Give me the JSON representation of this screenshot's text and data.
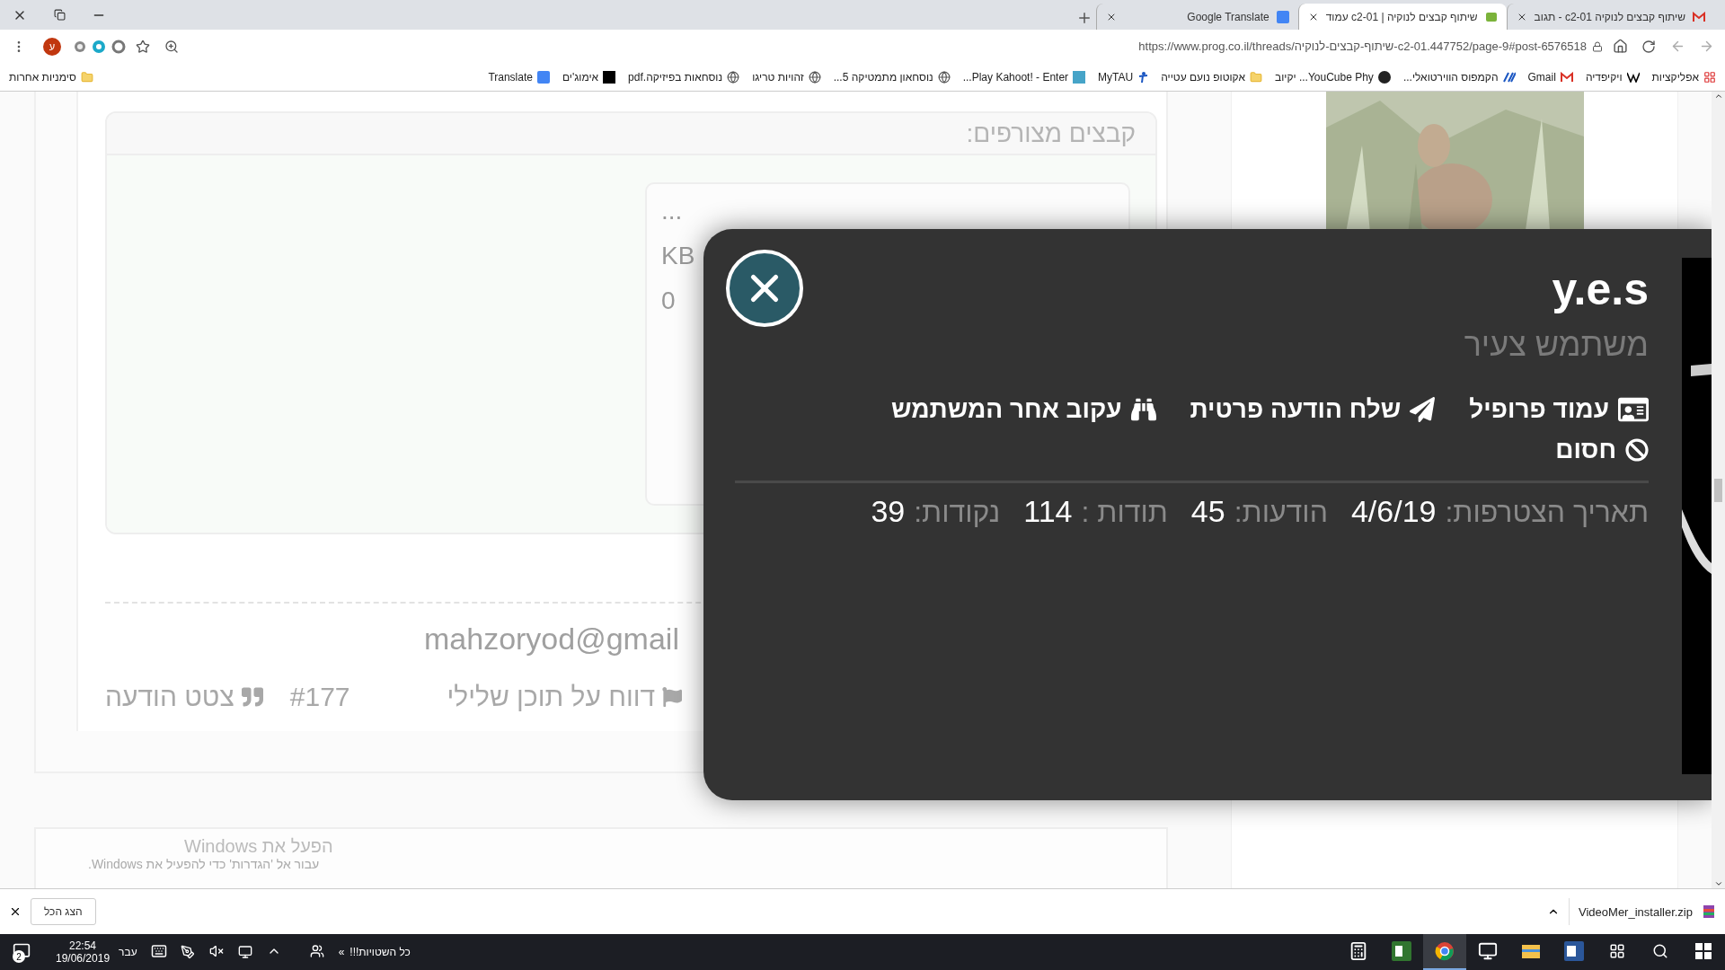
{
  "browser": {
    "tabs": [
      {
        "title": "שיתוף קבצים לנוקיה c2-01 - תגוב",
        "kind": "mail",
        "selected": false
      },
      {
        "title": "שיתוף קבצים לנוקיה | c2-01 עמוד",
        "kind": "forum",
        "selected": true
      },
      {
        "title": "Google Translate",
        "kind": "translate",
        "selected": false
      }
    ],
    "profile_initial": "ע",
    "url": "https://www.prog.co.il/threads/שיתוף-קבצים-לנוקיה-c2-01.447752/page-9#post-6576518",
    "bookmarks": [
      {
        "label": "אפליקציות",
        "kind": "apps"
      },
      {
        "label": "ויקיפדיה",
        "kind": "wiki"
      },
      {
        "label": "Gmail",
        "kind": "mail"
      },
      {
        "label": "הקמפוס הווירטואלי...",
        "kind": "campus"
      },
      {
        "label": "YouCube Phy... יקיוב",
        "kind": "m"
      },
      {
        "label": "אקוטופ נועם עטייה",
        "kind": "folder"
      },
      {
        "label": "MyTAU",
        "kind": "tau"
      },
      {
        "label": "Play Kahoot! - Enter...",
        "kind": "kahoot"
      },
      {
        "label": "נוסחאון מתמטיקה 5...",
        "kind": "globe"
      },
      {
        "label": "זהויות טריגו",
        "kind": "globe"
      },
      {
        "label": "נוסחאות בפיזיקה.pdf",
        "kind": "globe"
      },
      {
        "label": "אימוג'ים",
        "kind": "square"
      },
      {
        "label": "Translate",
        "kind": "translate"
      }
    ],
    "other_bookmarks": "סימניות אחרות"
  },
  "page": {
    "attachments": {
      "title": "קבצים מצורפים:",
      "file_lines": [
        "...",
        "KB",
        "0"
      ]
    },
    "signature": "mahzoryod@gmail",
    "post_actions": [
      {
        "label": "דווח על תוכן שלילי",
        "kind": "report"
      },
      {
        "label": "#177",
        "kind": "link"
      },
      {
        "label": "צטט הודעה",
        "kind": "quote"
      }
    ],
    "activation": {
      "title": "הפעל את Windows",
      "text": "עבור אל 'הגדרות' כדי להפעיל את Windows."
    }
  },
  "popup": {
    "username": "y.e.s",
    "rank": "משתמש צעיר",
    "actions": [
      {
        "label": "עמוד פרופיל",
        "kind": "profile"
      },
      {
        "label": "שלח הודעה פרטית",
        "kind": "message"
      },
      {
        "label": "עקוב אחר המשתמש",
        "kind": "follow"
      },
      {
        "label": "חסום",
        "kind": "block"
      }
    ],
    "stats": [
      {
        "label": "תאריך הצטרפות:",
        "value": "4/6/19"
      },
      {
        "label": "הודעות:",
        "value": "45"
      },
      {
        "label": "תודות :",
        "value": "114"
      },
      {
        "label": "נקודות:",
        "value": "39"
      }
    ]
  },
  "downloads": {
    "show_all": "הצג הכל",
    "file": "VideoMer_installer.zip"
  },
  "taskbar": {
    "notification_count": "2",
    "time": "22:54",
    "date": "19/06/2019",
    "language": "עבר",
    "toolbar_chevron": "«",
    "toolbar": "כל השטויות!!!",
    "apps": [
      {
        "kind": "calculator",
        "selected": false
      },
      {
        "kind": "project",
        "selected": false
      },
      {
        "kind": "chrome",
        "selected": true
      },
      {
        "kind": "monitor",
        "selected": false
      },
      {
        "kind": "explorer",
        "selected": false
      },
      {
        "kind": "word",
        "selected": false
      }
    ]
  }
}
